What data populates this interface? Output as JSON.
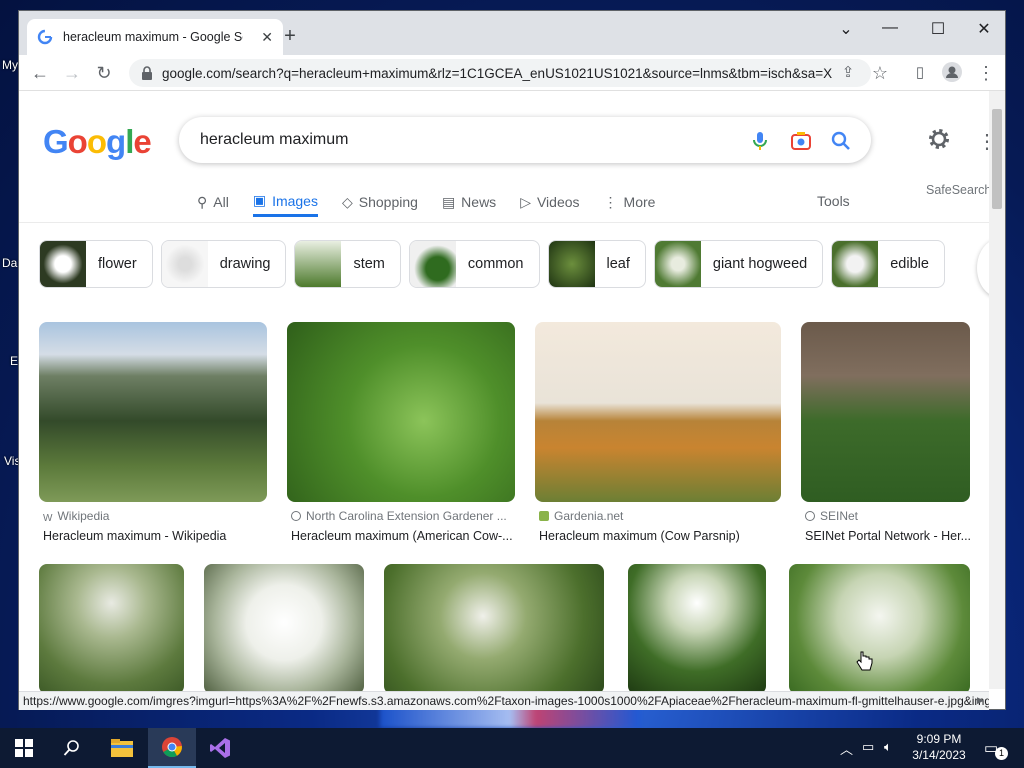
{
  "desktop": {
    "labels": [
      "My",
      "Da",
      "E",
      "Vis"
    ]
  },
  "browser": {
    "tab_title": "heracleum maximum - Google Search",
    "new_tab": "+",
    "url": "google.com/search?q=heracleum+maximum&rlz=1C1GCEA_enUS1021US1021&source=lnms&tbm=isch&sa=X&ved",
    "status_url": "https://www.google.com/imgres?imgurl=https%3A%2F%2Fnewfs.s3.amazonaws.com%2Ftaxon-images-1000s1000%2FApiaceae%2Fheracleum-maximum-fl-gmittelhauser-e.jpg&imgrefurl=..."
  },
  "google": {
    "logo": [
      "G",
      "o",
      "o",
      "g",
      "l",
      "e"
    ],
    "query": "heracleum maximum",
    "nav": [
      {
        "label": "All",
        "icon": "search-icon"
      },
      {
        "label": "Images",
        "icon": "image-icon",
        "active": true
      },
      {
        "label": "Shopping",
        "icon": "tag-icon"
      },
      {
        "label": "News",
        "icon": "news-icon"
      },
      {
        "label": "Videos",
        "icon": "video-icon"
      },
      {
        "label": "More",
        "icon": "more-vert-icon"
      }
    ],
    "tools": "Tools",
    "safesearch": "SafeSearch",
    "chips": [
      "flower",
      "drawing",
      "stem",
      "common",
      "leaf",
      "giant hogweed",
      "edible"
    ],
    "results_row1": [
      {
        "source": "Wikipedia",
        "caption": "Heracleum maximum - Wikipedia"
      },
      {
        "source": "North Carolina Extension Gardener ...",
        "caption": "Heracleum maximum (American Cow-..."
      },
      {
        "source": "Gardenia.net",
        "caption": "Heracleum maximum (Cow Parsnip)"
      },
      {
        "source": "SEINet",
        "caption": "SEINet Portal Network - Her..."
      }
    ]
  },
  "taskbar": {
    "time": "9:09 PM",
    "date": "3/14/2023",
    "notifications": "1"
  },
  "colors": {
    "google_blue": "#4285f4",
    "google_red": "#ea4335",
    "google_yellow": "#fbbc05",
    "google_green": "#34a853",
    "link_blue": "#1a73e8"
  }
}
